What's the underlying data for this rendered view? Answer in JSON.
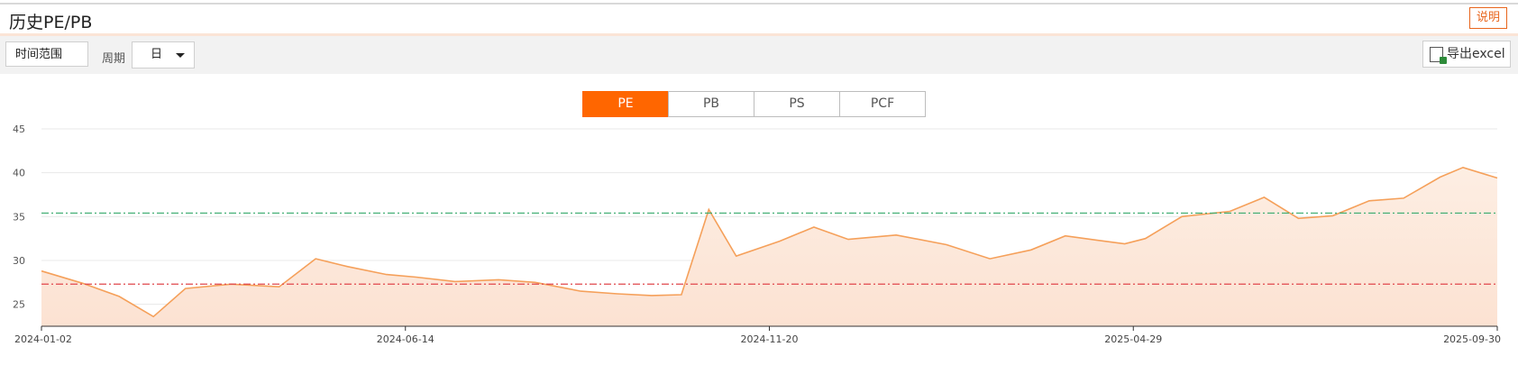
{
  "header": {
    "title": "历史PE/PB",
    "explain_label": "说明"
  },
  "toolbar": {
    "range_label": "时间范围",
    "period_label": "周期",
    "period_value": "日",
    "export_label": "导出excel"
  },
  "tabs": [
    {
      "label": "PE",
      "active": true
    },
    {
      "label": "PB",
      "active": false
    },
    {
      "label": "PS",
      "active": false
    },
    {
      "label": "PCF",
      "active": false
    }
  ],
  "colors": {
    "accent": "#ff6600",
    "series": "#f5a05a",
    "upper_line": "#3aab6e",
    "lower_line": "#e0474c"
  },
  "chart_data": {
    "type": "area",
    "ylim": [
      22.5,
      45
    ],
    "y_ticks": [
      25,
      30,
      35,
      40,
      45
    ],
    "x_tick_labels": [
      "2024-01-02",
      "2024-06-14",
      "2024-11-20",
      "2025-04-29",
      "2025-09-30"
    ],
    "reference_lines": [
      {
        "value": 35.4,
        "color": "#3aab6e",
        "style": "dash-dot"
      },
      {
        "value": 27.3,
        "color": "#e0474c",
        "style": "dash-dot"
      }
    ],
    "series": [
      {
        "x": [
          "2024-01-02",
          "2024-01-20",
          "2024-02-05",
          "2024-02-20",
          "2024-03-05",
          "2024-03-25",
          "2024-04-15",
          "2024-05-01",
          "2024-05-15",
          "2024-06-01",
          "2024-06-14",
          "2024-07-01",
          "2024-07-20",
          "2024-08-05",
          "2024-08-25",
          "2024-09-10",
          "2024-09-25",
          "2024-10-08",
          "2024-10-20",
          "2024-11-01",
          "2024-11-20",
          "2024-12-05",
          "2024-12-20",
          "2025-01-10",
          "2025-02-01",
          "2025-02-20",
          "2025-03-10",
          "2025-03-25",
          "2025-04-08",
          "2025-04-20",
          "2025-04-29",
          "2025-05-15",
          "2025-06-05",
          "2025-06-20",
          "2025-07-05",
          "2025-07-20",
          "2025-08-05",
          "2025-08-20",
          "2025-09-05",
          "2025-09-15",
          "2025-09-30"
        ],
        "values": [
          28.8,
          27.4,
          25.9,
          23.6,
          26.8,
          27.3,
          27.0,
          30.2,
          29.3,
          28.4,
          28.1,
          27.6,
          27.8,
          27.5,
          26.5,
          26.2,
          26.0,
          26.1,
          35.8,
          30.5,
          32.2,
          33.8,
          32.4,
          32.9,
          31.8,
          30.2,
          31.2,
          32.8,
          32.3,
          31.9,
          32.5,
          35.0,
          35.6,
          37.2,
          34.8,
          35.1,
          36.8,
          37.1,
          39.5,
          40.6,
          39.4
        ]
      }
    ]
  }
}
